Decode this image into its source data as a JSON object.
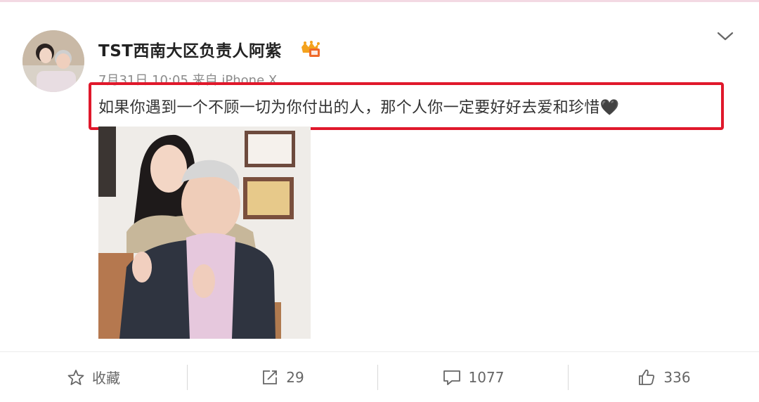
{
  "post": {
    "username": "TST西南大区负责人阿紫",
    "meta": "7月31日 10:05 来自 iPhone X",
    "text": "如果你遇到一个不顾一切为你付出的人，那个人你一定要好好去爱和珍惜",
    "emoji": "🖤",
    "icons": {
      "avatar": "user-avatar",
      "vip": "vip-crown-icon",
      "menu": "chevron-down-icon"
    }
  },
  "actions": {
    "favorite_label": "收藏",
    "repost_count": "29",
    "comment_count": "1077",
    "like_count": "336"
  },
  "colors": {
    "highlight": "#e0182b",
    "text": "#333333",
    "muted": "#8c8c8c"
  }
}
